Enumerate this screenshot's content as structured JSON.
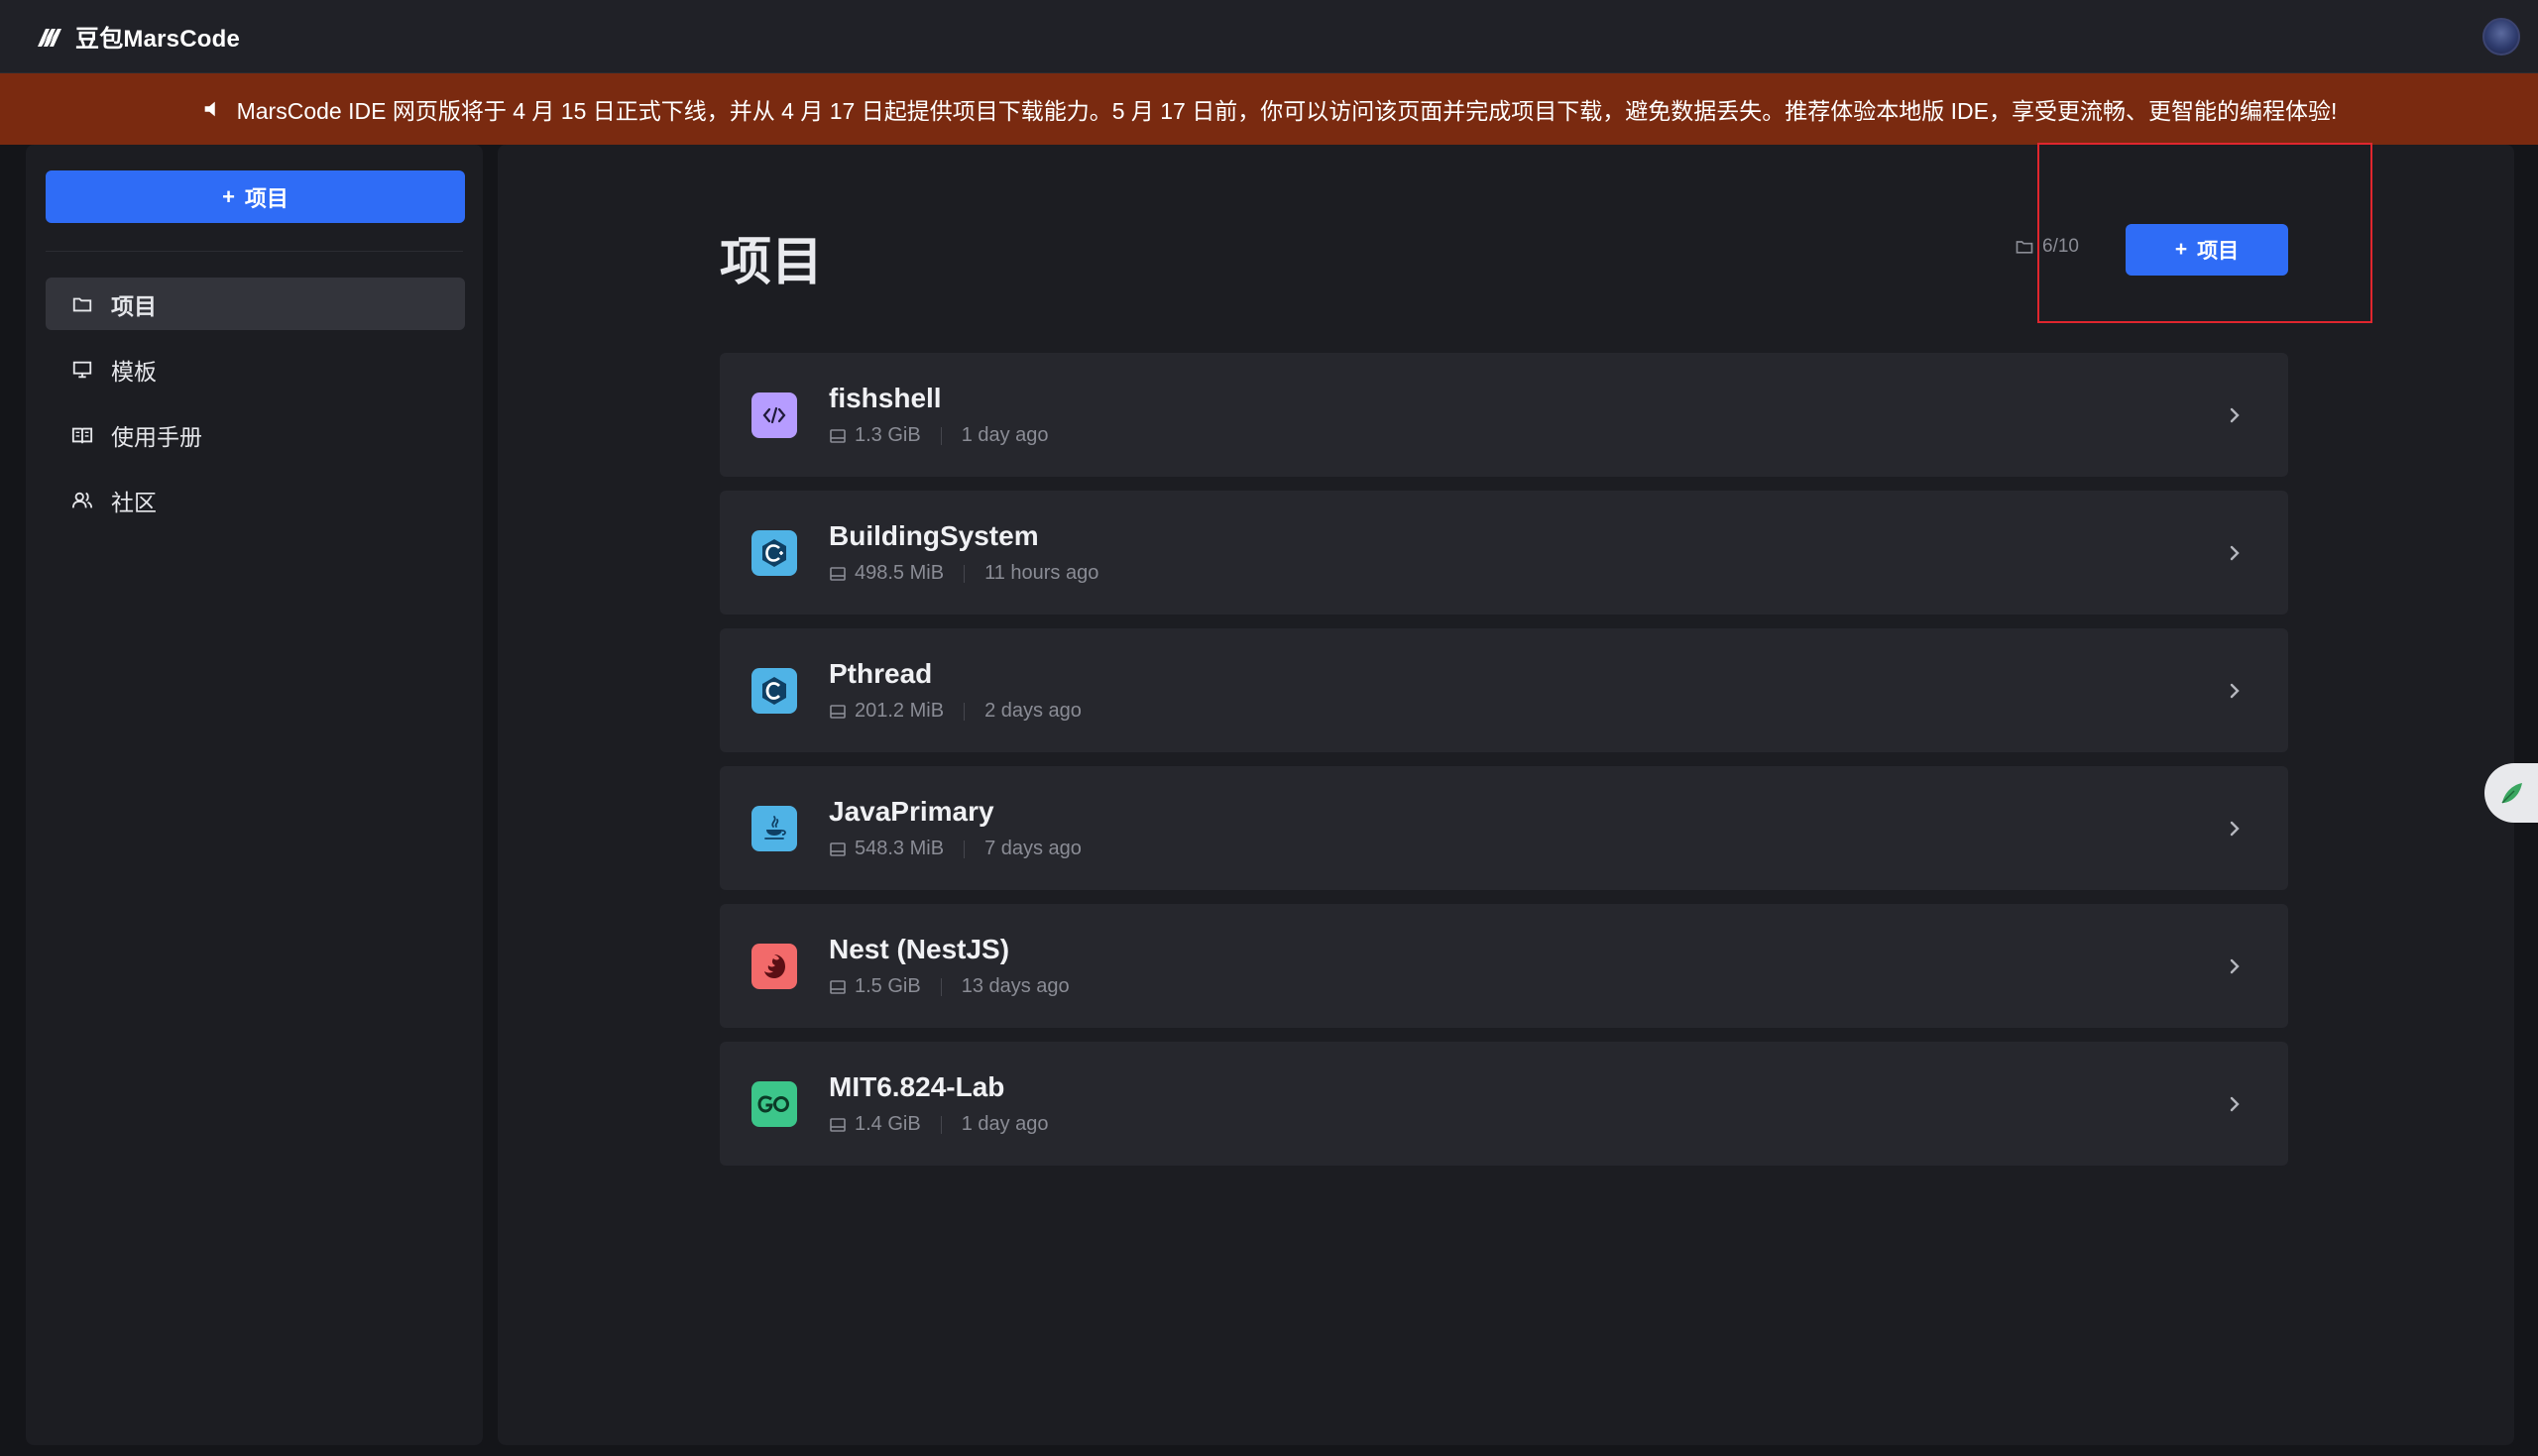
{
  "app": {
    "brand_name": "豆包MarsCode"
  },
  "banner": {
    "text": "MarsCode IDE 网页版将于 4 月 15 日正式下线，并从 4 月 17 日起提供项目下载能力。5 月 17 日前，你可以访问该页面并完成项目下载，避免数据丢失。推荐体验本地版 IDE，享受更流畅、更智能的编程体验!"
  },
  "sidebar": {
    "new_project_label": "项目",
    "items": [
      {
        "label": "项目",
        "icon": "folder-icon",
        "active": true
      },
      {
        "label": "模板",
        "icon": "monitor-icon",
        "active": false
      },
      {
        "label": "使用手册",
        "icon": "book-icon",
        "active": false
      },
      {
        "label": "社区",
        "icon": "users-icon",
        "active": false
      }
    ]
  },
  "main": {
    "title": "项目",
    "quota": "6/10",
    "new_project_label": "项目"
  },
  "projects": [
    {
      "name": "fishshell",
      "size": "1.3 GiB",
      "updated": "1 day ago",
      "icon": "code-icon",
      "color": "#b69cff"
    },
    {
      "name": "BuildingSystem",
      "size": "498.5 MiB",
      "updated": "11 hours ago",
      "icon": "cpp-icon",
      "color": "#4fb3e6"
    },
    {
      "name": "Pthread",
      "size": "201.2 MiB",
      "updated": "2 days ago",
      "icon": "c-icon",
      "color": "#4fb3e6"
    },
    {
      "name": "JavaPrimary",
      "size": "548.3 MiB",
      "updated": "7 days ago",
      "icon": "java-icon",
      "color": "#4fb3e6"
    },
    {
      "name": "Nest (NestJS)",
      "size": "1.5 GiB",
      "updated": "13 days ago",
      "icon": "nestjs-icon",
      "color": "#f26a6a"
    },
    {
      "name": "MIT6.824-Lab",
      "size": "1.4 GiB",
      "updated": "1 day ago",
      "icon": "go-icon",
      "color": "#3cc68a"
    }
  ],
  "colors": {
    "accent": "#2f6cf6",
    "banner_bg": "#7a2a10",
    "highlight": "#e0262e"
  }
}
